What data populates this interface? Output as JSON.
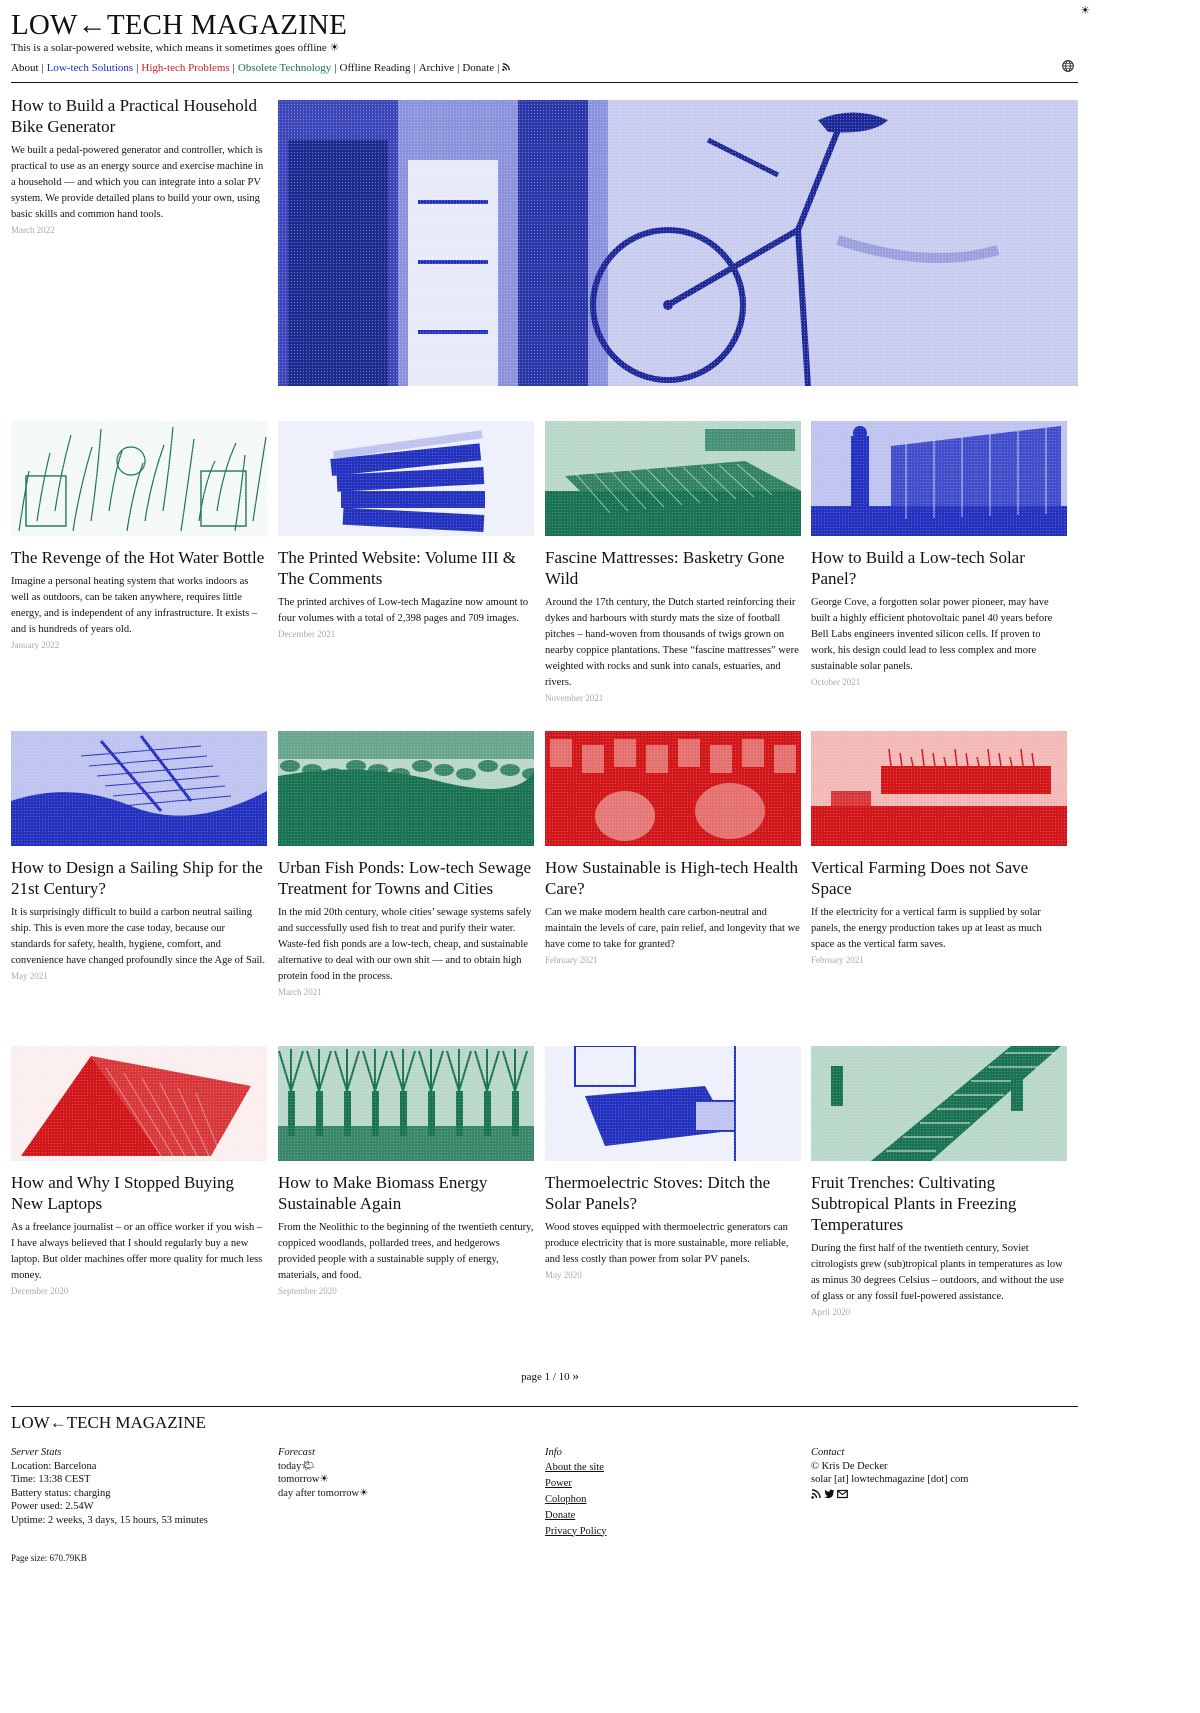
{
  "site": {
    "logo": "LOW←TECH MAGAZINE",
    "tagline": "This is a solar-powered website, which means it sometimes goes offline ☀",
    "top_icon": "☀"
  },
  "nav": [
    {
      "label": "About",
      "color": "#111111"
    },
    {
      "label": "Low-tech Solutions",
      "color": "#1d2fbd"
    },
    {
      "label": "High-tech Problems",
      "color": "#d01f1f"
    },
    {
      "label": "Obsolete Technology",
      "color": "#16704f"
    },
    {
      "label": "Offline Reading",
      "color": "#111111"
    },
    {
      "label": "Archive",
      "color": "#111111"
    },
    {
      "label": "Donate",
      "color": "#111111"
    }
  ],
  "nav_icons": {
    "rss": "rss-icon",
    "language": "globe-icon"
  },
  "colors": {
    "blue": "#2432c0",
    "red": "#d2171b",
    "green": "#1a7352"
  },
  "featured": {
    "title": "How to Build a Practical Household Bike Generator",
    "desc": "We built a pedal-powered generator and controller, which is practical to use as an energy source and exercise machine in a household — and which you can integrate into a solar PV system. We provide detailed plans to build your own, using basic skills and common hand tools.",
    "date": "March 2022",
    "image_color": "blue"
  },
  "articles": [
    {
      "title": "The Revenge of the Hot Water Bottle",
      "desc": "Imagine a personal heating system that works indoors as well as outdoors, can be taken anywhere, requires little energy, and is independent of any infrastructure. It exists – and is hundreds of years old.",
      "date": "January 2022",
      "color": "green"
    },
    {
      "title": "The Printed Website: Volume III & The Comments",
      "desc": "The printed archives of Low-tech Magazine now amount to four volumes with a total of 2,398 pages and 709 images.",
      "date": "December 2021",
      "color": "blue"
    },
    {
      "title": "Fascine Mattresses: Basketry Gone Wild",
      "desc": "Around the 17th century, the Dutch started reinforcing their dykes and harbours with sturdy mats the size of football pitches – hand-woven from thousands of twigs grown on nearby coppice plantations. These “fascine mattresses” were weighted with rocks and sunk into canals, estuaries, and rivers.",
      "date": "November 2021",
      "color": "green"
    },
    {
      "title": "How to Build a Low-tech Solar Panel?",
      "desc": "George Cove, a forgotten solar power pioneer, may have built a highly efficient photovoltaic panel 40 years before Bell Labs engineers invented silicon cells. If proven to work, his design could lead to less complex and more sustainable solar panels.",
      "date": "October 2021",
      "color": "blue"
    },
    {
      "title": "How to Design a Sailing Ship for the 21st Century?",
      "desc": "It is surprisingly difficult to build a carbon neutral sailing ship. This is even more the case today, because our standards for safety, health, hygiene, comfort, and convenience have changed profoundly since the Age of Sail.",
      "date": "May 2021",
      "color": "blue"
    },
    {
      "title": "Urban Fish Ponds: Low-tech Sewage Treatment for Towns and Cities",
      "desc": "In the mid 20th century, whole cities’ sewage systems safely and successfully used fish to treat and purify their water. Waste-fed fish ponds are a low-tech, cheap, and sustainable alternative to deal with our own shit — and to obtain high protein food in the process.",
      "date": "March 2021",
      "color": "green"
    },
    {
      "title": "How Sustainable is High-tech Health Care?",
      "desc": "Can we make modern health care carbon-neutral and maintain the levels of care, pain relief, and longevity that we have come to take for granted?",
      "date": "February 2021",
      "color": "red"
    },
    {
      "title": "Vertical Farming Does not Save Space",
      "desc": "If the electricity for a vertical farm is supplied by solar panels, the energy production takes up at least as much space as the vertical farm saves.",
      "date": "February 2021",
      "color": "red"
    },
    {
      "title": "How and Why I Stopped Buying New Laptops",
      "desc": "As a freelance journalist – or an office worker if you wish – I have always believed that I should regularly buy a new laptop. But older machines offer more quality for much less money.",
      "date": "December 2020",
      "color": "red"
    },
    {
      "title": "How to Make Biomass Energy Sustainable Again",
      "desc": "From the Neolithic to the beginning of the twentieth century, coppiced woodlands, pollarded trees, and hedgerows provided people with a sustainable supply of energy, materials, and food.",
      "date": "September 2020",
      "color": "green"
    },
    {
      "title": "Thermoelectric Stoves: Ditch the Solar Panels?",
      "desc": "Wood stoves equipped with thermoelectric generators can produce electricity that is more sustainable, more reliable, and less costly than power from solar PV panels.",
      "date": "May 2020",
      "color": "blue"
    },
    {
      "title": "Fruit Trenches: Cultivating Subtropical Plants in Freezing Temperatures",
      "desc": "During the first half of the twentieth century, Soviet citrologists grew (sub)tropical plants in temperatures as low as minus 30 degrees Celsius – outdoors, and without the use of glass or any fossil fuel-powered assistance.",
      "date": "April 2020",
      "color": "green"
    }
  ],
  "pager": {
    "text": "page 1 / 10",
    "next": "»"
  },
  "footer": {
    "logo": "LOW←TECH MAGAZINE",
    "server_stats": {
      "heading": "Server Stats",
      "lines": [
        "Location: Barcelona",
        "Time: 13:38 CEST",
        "Battery status: charging",
        "Power used: 2.54W",
        "Uptime: 2 weeks, 3 days, 15 hours, 53 minutes"
      ]
    },
    "forecast": {
      "heading": "Forecast",
      "lines": [
        "today🌤",
        "tomorrow☀",
        "day after tomorrow☀"
      ]
    },
    "info": {
      "heading": "Info",
      "links": [
        "About the site",
        "Power",
        "Colophon",
        "Donate",
        "Privacy Policy"
      ]
    },
    "contact": {
      "heading": "Contact",
      "lines": [
        "© Kris De Decker",
        "solar [at] lowtechmagazine [dot] com"
      ],
      "icons": [
        "rss-icon",
        "twitter-icon",
        "mail-icon"
      ]
    },
    "page_size": "Page size: 670.79KB"
  }
}
